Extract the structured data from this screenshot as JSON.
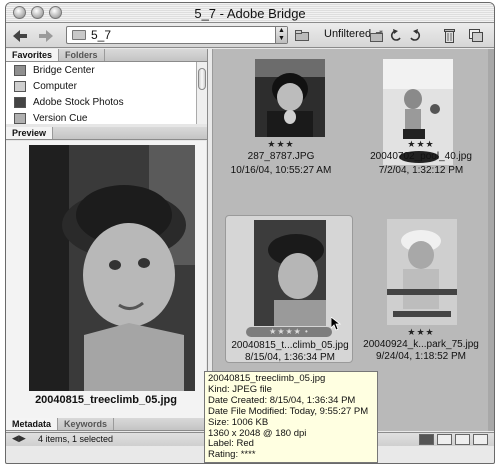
{
  "window": {
    "title": "5_7 - Adobe Bridge"
  },
  "toolbar": {
    "back": "◀",
    "forward": "▶",
    "path_value": "5_7",
    "filter_label": "Unfiltered"
  },
  "left_panel": {
    "tabs_top": [
      "Favorites",
      "Folders"
    ],
    "favorites": [
      "Bridge Center",
      "Computer",
      "Adobe Stock Photos",
      "Version Cue"
    ],
    "preview_tab": "Preview",
    "preview_filename": "20040815_treeclimb_05.jpg",
    "tabs_bottom": [
      "Metadata",
      "Keywords"
    ]
  },
  "status_bar": {
    "text": "4 items, 1 selected"
  },
  "thumbnails": [
    {
      "stars": "★★★",
      "name": "287_8787.JPG",
      "date": "10/16/04, 10:55:27 AM",
      "selected": false
    },
    {
      "stars": "★★★",
      "name": "20040702_pool_40.jpg",
      "date": "7/2/04, 1:32:12 PM",
      "selected": false
    },
    {
      "stars": "★★★★ •",
      "name": "20040815_t...climb_05.jpg",
      "date": "8/15/04, 1:36:34 PM",
      "selected": true
    },
    {
      "stars": "★★★",
      "name": "20040924_k...park_75.jpg",
      "date": "9/24/04, 1:18:52 PM",
      "selected": false
    }
  ],
  "tooltip": {
    "lines": [
      "20040815_treeclimb_05.jpg",
      "Kind: JPEG file",
      "Date Created: 8/15/04, 1:36:34 PM",
      "Date File Modified: Today, 9:55:27 PM",
      "Size: 1006 KB",
      "1360 x 2048 @ 180 dpi",
      "Label: Red",
      "Rating: ****"
    ]
  },
  "icons": [
    "back-arrow-icon",
    "forward-arrow-icon",
    "folder-icon",
    "new-folder-icon",
    "rotate-left-icon",
    "rotate-right-icon",
    "trash-icon",
    "compact-mode-icon"
  ]
}
